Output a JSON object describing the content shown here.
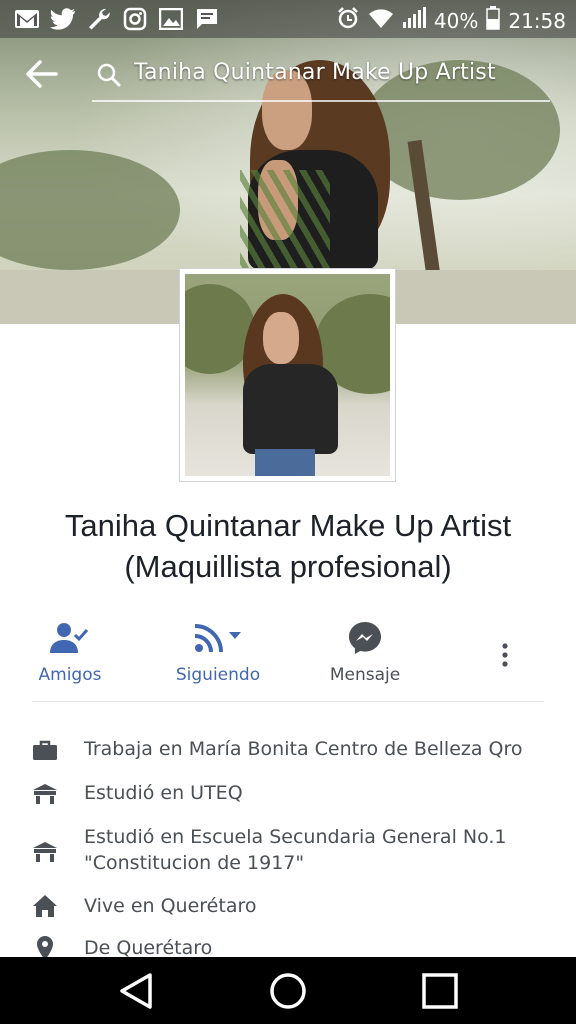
{
  "status_bar": {
    "battery": "40%",
    "time": "21:58",
    "icons": [
      "gmail-icon",
      "twitter-icon",
      "wrench-icon",
      "instagram-icon",
      "gallery-icon",
      "message-icon",
      "alarm-icon",
      "wifi-icon",
      "signal-icon",
      "battery-icon"
    ]
  },
  "toolbar": {
    "search_text": "Taniha Quintanar Make Up Artist"
  },
  "profile": {
    "name_line1": "Taniha Quintanar Make Up Artist",
    "name_line2": "(Maquillista profesional)"
  },
  "actions": {
    "friends": "Amigos",
    "following": "Siguiendo",
    "message": "Mensaje"
  },
  "info": [
    {
      "icon": "briefcase-icon",
      "text": "Trabaja en María Bonita Centro de Belleza Qro"
    },
    {
      "icon": "school-icon",
      "text": "Estudió en UTEQ"
    },
    {
      "icon": "school-icon",
      "text": "Estudió en Escuela Secundaria General No.1 \"Constitucion de 1917\""
    },
    {
      "icon": "home-icon",
      "text": "Vive en Querétaro"
    },
    {
      "icon": "location-pin-icon",
      "text": "De Querétaro"
    }
  ],
  "colors": {
    "accent": "#4267b2",
    "secondary_text": "#4b4f56",
    "primary_text": "#1d2129"
  }
}
